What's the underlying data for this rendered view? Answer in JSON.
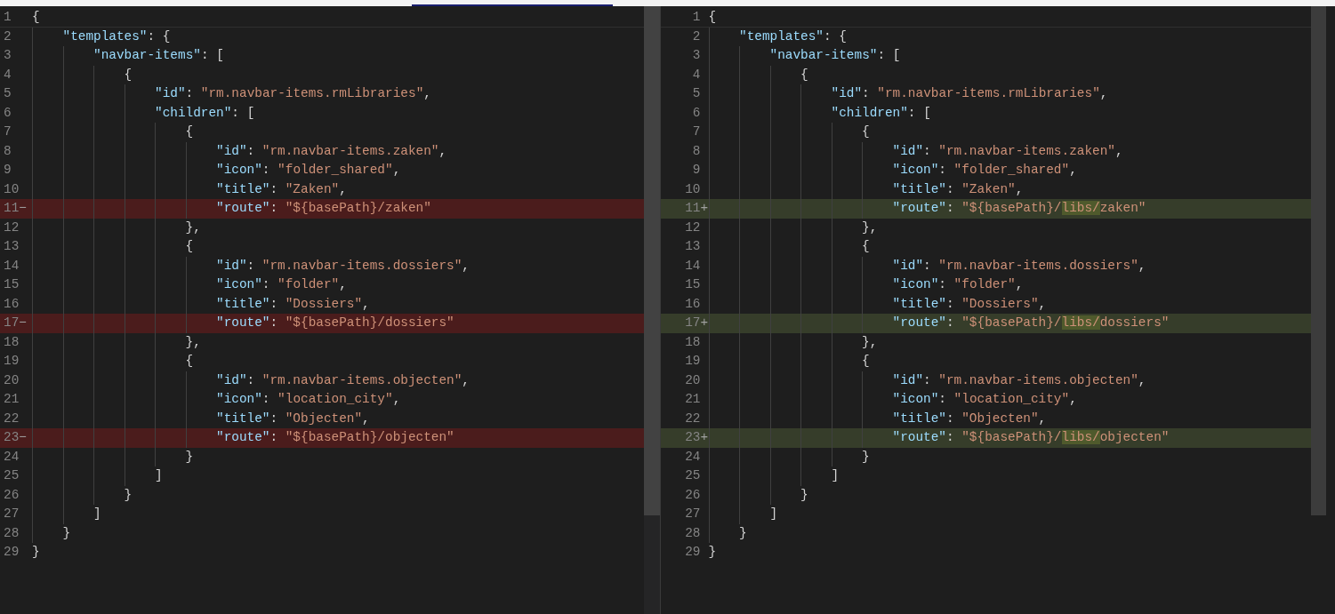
{
  "panes": [
    {
      "lines": [
        {
          "number": "1",
          "kind": "plain",
          "current": true,
          "code": "{"
        },
        {
          "number": "2",
          "kind": "plain",
          "code": "\"templates\": {"
        },
        {
          "number": "3",
          "kind": "plain",
          "code": "\"navbar-items\": ["
        },
        {
          "number": "4",
          "kind": "plain",
          "code": "{"
        },
        {
          "number": "5",
          "kind": "plain",
          "code": "\"id\": \"rm.navbar-items.rmLibraries\","
        },
        {
          "number": "6",
          "kind": "plain",
          "code": "\"children\": ["
        },
        {
          "number": "7",
          "kind": "plain",
          "code": "{"
        },
        {
          "number": "8",
          "kind": "plain",
          "code": "\"id\": \"rm.navbar-items.zaken\","
        },
        {
          "number": "9",
          "kind": "plain",
          "code": "\"icon\": \"folder_shared\","
        },
        {
          "number": "10",
          "kind": "plain",
          "code": "\"title\": \"Zaken\","
        },
        {
          "number": "11",
          "kind": "removed",
          "marker": "−",
          "code": "\"route\": \"${basePath}/zaken\""
        },
        {
          "number": "12",
          "kind": "plain",
          "code": "},"
        },
        {
          "number": "13",
          "kind": "plain",
          "code": "{"
        },
        {
          "number": "14",
          "kind": "plain",
          "code": "\"id\": \"rm.navbar-items.dossiers\","
        },
        {
          "number": "15",
          "kind": "plain",
          "code": "\"icon\": \"folder\","
        },
        {
          "number": "16",
          "kind": "plain",
          "code": "\"title\": \"Dossiers\","
        },
        {
          "number": "17",
          "kind": "removed",
          "marker": "−",
          "code": "\"route\": \"${basePath}/dossiers\""
        },
        {
          "number": "18",
          "kind": "plain",
          "code": "},"
        },
        {
          "number": "19",
          "kind": "plain",
          "code": "{"
        },
        {
          "number": "20",
          "kind": "plain",
          "code": "\"id\": \"rm.navbar-items.objecten\","
        },
        {
          "number": "21",
          "kind": "plain",
          "code": "\"icon\": \"location_city\","
        },
        {
          "number": "22",
          "kind": "plain",
          "code": "\"title\": \"Objecten\","
        },
        {
          "number": "23",
          "kind": "removed",
          "marker": "−",
          "code": "\"route\": \"${basePath}/objecten\""
        },
        {
          "number": "24",
          "kind": "plain",
          "code": "}"
        },
        {
          "number": "25",
          "kind": "plain",
          "code": "]"
        },
        {
          "number": "26",
          "kind": "plain",
          "code": "}"
        },
        {
          "number": "27",
          "kind": "plain",
          "code": "]"
        },
        {
          "number": "28",
          "kind": "plain",
          "code": "}"
        },
        {
          "number": "29",
          "kind": "plain",
          "code": "}"
        }
      ]
    },
    {
      "lines": [
        {
          "number": "1",
          "kind": "plain",
          "current": true,
          "code": "{"
        },
        {
          "number": "2",
          "kind": "plain",
          "code": "\"templates\": {"
        },
        {
          "number": "3",
          "kind": "plain",
          "code": "\"navbar-items\": ["
        },
        {
          "number": "4",
          "kind": "plain",
          "code": "{"
        },
        {
          "number": "5",
          "kind": "plain",
          "code": "\"id\": \"rm.navbar-items.rmLibraries\","
        },
        {
          "number": "6",
          "kind": "plain",
          "code": "\"children\": ["
        },
        {
          "number": "7",
          "kind": "plain",
          "code": "{"
        },
        {
          "number": "8",
          "kind": "plain",
          "code": "\"id\": \"rm.navbar-items.zaken\","
        },
        {
          "number": "9",
          "kind": "plain",
          "code": "\"icon\": \"folder_shared\","
        },
        {
          "number": "10",
          "kind": "plain",
          "code": "\"title\": \"Zaken\","
        },
        {
          "number": "11",
          "kind": "added",
          "marker": "+",
          "segments": [
            {
              "text": "\"route\": \"${basePath}/"
            },
            {
              "text": "libs/",
              "changed": true
            },
            {
              "text": "zaken\""
            }
          ]
        },
        {
          "number": "12",
          "kind": "plain",
          "code": "},"
        },
        {
          "number": "13",
          "kind": "plain",
          "code": "{"
        },
        {
          "number": "14",
          "kind": "plain",
          "code": "\"id\": \"rm.navbar-items.dossiers\","
        },
        {
          "number": "15",
          "kind": "plain",
          "code": "\"icon\": \"folder\","
        },
        {
          "number": "16",
          "kind": "plain",
          "code": "\"title\": \"Dossiers\","
        },
        {
          "number": "17",
          "kind": "added",
          "marker": "+",
          "segments": [
            {
              "text": "\"route\": \"${basePath}/"
            },
            {
              "text": "libs/",
              "changed": true
            },
            {
              "text": "dossiers\""
            }
          ]
        },
        {
          "number": "18",
          "kind": "plain",
          "code": "},"
        },
        {
          "number": "19",
          "kind": "plain",
          "code": "{"
        },
        {
          "number": "20",
          "kind": "plain",
          "code": "\"id\": \"rm.navbar-items.objecten\","
        },
        {
          "number": "21",
          "kind": "plain",
          "code": "\"icon\": \"location_city\","
        },
        {
          "number": "22",
          "kind": "plain",
          "code": "\"title\": \"Objecten\","
        },
        {
          "number": "23",
          "kind": "added",
          "marker": "+",
          "segments": [
            {
              "text": "\"route\": \"${basePath}/"
            },
            {
              "text": "libs/",
              "changed": true
            },
            {
              "text": "objecten\""
            }
          ]
        },
        {
          "number": "24",
          "kind": "plain",
          "code": "}"
        },
        {
          "number": "25",
          "kind": "plain",
          "code": "]"
        },
        {
          "number": "26",
          "kind": "plain",
          "code": "}"
        },
        {
          "number": "27",
          "kind": "plain",
          "code": "]"
        },
        {
          "number": "28",
          "kind": "plain",
          "code": "}"
        },
        {
          "number": "29",
          "kind": "plain",
          "code": "}"
        }
      ]
    }
  ]
}
